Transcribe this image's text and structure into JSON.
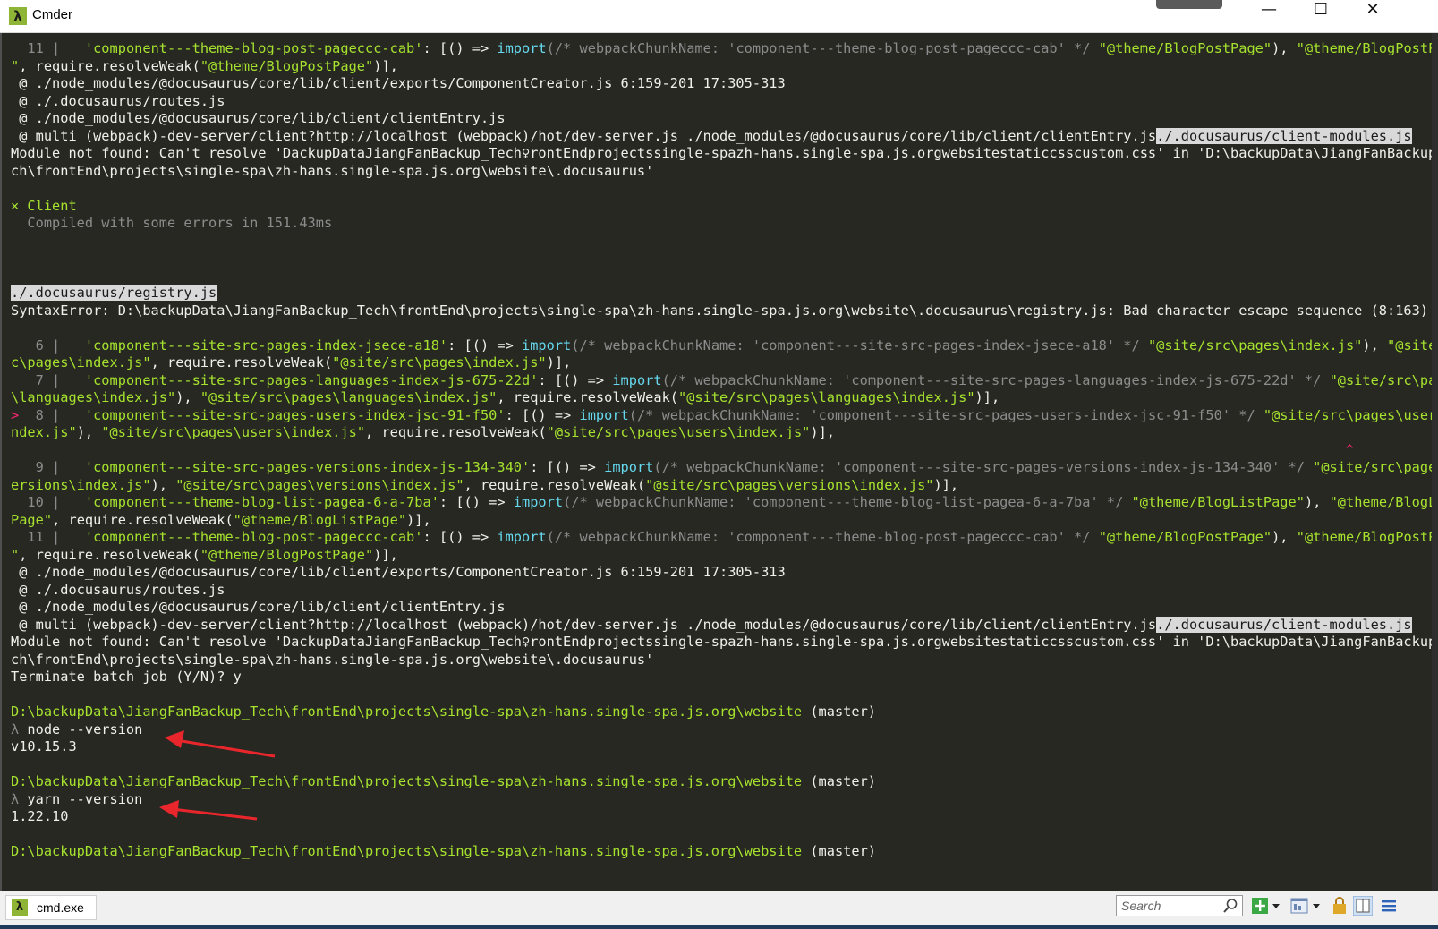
{
  "window": {
    "title": "Cmder",
    "ghost_tabs": [
      "...",
      "...",
      "...",
      "...",
      "...",
      "..."
    ],
    "controls": {
      "minimize": "—",
      "maximize": "☐",
      "close": "✕"
    }
  },
  "terminal": {
    "lines": [
      {
        "segs": [
          [
            "  11 | ",
            "gray"
          ],
          [
            "  ",
            ""
          ],
          [
            "'component---theme-blog-post-pageccc-cab'",
            "gn"
          ],
          [
            ": [() => ",
            ""
          ],
          [
            "import",
            "bl"
          ],
          [
            "(/* webpackChunkName: 'component---theme-blog-post-pageccc-cab' */ ",
            "gray"
          ],
          [
            "\"@theme/BlogPostPage\"",
            "gn"
          ],
          [
            "), ",
            ""
          ],
          [
            "\"@theme/BlogPostPage",
            "gn"
          ]
        ]
      },
      {
        "segs": [
          [
            "\"",
            "gn"
          ],
          [
            ", require.resolveWeak(",
            ""
          ],
          [
            "\"@theme/BlogPostPage\"",
            "gn"
          ],
          [
            ")],",
            ""
          ]
        ]
      },
      {
        "segs": [
          [
            " @ ./node_modules/@docusaurus/core/lib/client/exports/ComponentCreator.js 6:159-201 17:305-313",
            ""
          ]
        ]
      },
      {
        "segs": [
          [
            " @ ./.docusaurus/routes.js",
            ""
          ]
        ]
      },
      {
        "segs": [
          [
            " @ ./node_modules/@docusaurus/core/lib/client/clientEntry.js",
            ""
          ]
        ]
      },
      {
        "segs": [
          [
            " @ multi (webpack)-dev-server/client?http://localhost (webpack)/hot/dev-server.js ./node_modules/@docusaurus/core/lib/client/clientEntry.js",
            ""
          ],
          [
            "./.docusaurus/client-modules.js",
            "hl"
          ]
        ]
      },
      {
        "segs": [
          [
            "Module not found: Can't resolve 'DackupDataJiangFanBackup_Tech♀rontEndprojectssingle-spazh-hans.single-spa.js.orgwebsitestaticcsscustom.css' in 'D:\\backupData\\JiangFanBackup_Te",
            ""
          ]
        ]
      },
      {
        "segs": [
          [
            "ch\\frontEnd\\projects\\single-spa\\zh-hans.single-spa.js.org\\website\\.docusaurus'",
            ""
          ]
        ]
      },
      {
        "segs": [
          [
            "",
            ""
          ]
        ]
      },
      {
        "segs": [
          [
            "× Client",
            "gn"
          ]
        ]
      },
      {
        "segs": [
          [
            "  Compiled with some errors in 151.43ms",
            "gray"
          ]
        ]
      },
      {
        "segs": [
          [
            "",
            ""
          ]
        ]
      },
      {
        "segs": [
          [
            "",
            ""
          ]
        ]
      },
      {
        "segs": [
          [
            "",
            ""
          ]
        ]
      },
      {
        "segs": [
          [
            "./.docusaurus/registry.js",
            "hl"
          ]
        ]
      },
      {
        "segs": [
          [
            "SyntaxError: D:\\backupData\\JiangFanBackup_Tech\\frontEnd\\projects\\single-spa\\zh-hans.single-spa.js.org\\website\\.docusaurus\\registry.js: Bad character escape sequence (8:163)",
            ""
          ]
        ]
      },
      {
        "segs": [
          [
            "",
            ""
          ]
        ]
      },
      {
        "segs": [
          [
            "   6 | ",
            "gray"
          ],
          [
            "  ",
            ""
          ],
          [
            "'component---site-src-pages-index-jsece-a18'",
            "gn"
          ],
          [
            ": [() => ",
            ""
          ],
          [
            "import",
            "bl"
          ],
          [
            "(/* webpackChunkName: 'component---site-src-pages-index-jsece-a18' */ ",
            "gray"
          ],
          [
            "\"@site/src\\pages\\index.js\"",
            "gn"
          ],
          [
            "), ",
            ""
          ],
          [
            "\"@site/sr",
            "gn"
          ]
        ]
      },
      {
        "segs": [
          [
            "c\\pages\\index.js\"",
            "gn"
          ],
          [
            ", require.resolveWeak(",
            ""
          ],
          [
            "\"@site/src\\pages\\index.js\"",
            "gn"
          ],
          [
            ")],",
            ""
          ]
        ]
      },
      {
        "segs": [
          [
            "   7 | ",
            "gray"
          ],
          [
            "  ",
            ""
          ],
          [
            "'component---site-src-pages-languages-index-js-675-22d'",
            "gn"
          ],
          [
            ": [() => ",
            ""
          ],
          [
            "import",
            "bl"
          ],
          [
            "(/* webpackChunkName: 'component---site-src-pages-languages-index-js-675-22d' */ ",
            "gray"
          ],
          [
            "\"@site/src\\pages",
            "gn"
          ]
        ]
      },
      {
        "segs": [
          [
            "\\languages\\index.js\"",
            "gn"
          ],
          [
            "), ",
            ""
          ],
          [
            "\"@site/src\\pages\\languages\\index.js\"",
            "gn"
          ],
          [
            ", require.resolveWeak(",
            ""
          ],
          [
            "\"@site/src\\pages\\languages\\index.js\"",
            "gn"
          ],
          [
            ")],",
            ""
          ]
        ]
      },
      {
        "segs": [
          [
            "> ",
            "rd"
          ],
          [
            " 8 | ",
            "gray"
          ],
          [
            "  ",
            ""
          ],
          [
            "'component---site-src-pages-users-index-jsc-91-f50'",
            "gn"
          ],
          [
            ": [() => ",
            ""
          ],
          [
            "import",
            "bl"
          ],
          [
            "(/* webpackChunkName: 'component---site-src-pages-users-index-jsc-91-f50' */ ",
            "gray"
          ],
          [
            "\"@site/src\\pages\\users\\i",
            "gn"
          ]
        ]
      },
      {
        "segs": [
          [
            "ndex.js\"",
            "gn"
          ],
          [
            "), ",
            ""
          ],
          [
            "\"@site/src\\pages\\users\\index.js\"",
            "gn"
          ],
          [
            ", require.resolveWeak(",
            ""
          ],
          [
            "\"@site/src\\pages\\users\\index.js\"",
            "gn"
          ],
          [
            ")],",
            ""
          ]
        ]
      },
      {
        "segs": [
          [
            "",
            ""
          ]
        ]
      },
      {
        "segs": [
          [
            "   9 | ",
            "gray"
          ],
          [
            "  ",
            ""
          ],
          [
            "'component---site-src-pages-versions-index-js-134-340'",
            "gn"
          ],
          [
            ": [() => ",
            ""
          ],
          [
            "import",
            "bl"
          ],
          [
            "(/* webpackChunkName: 'component---site-src-pages-versions-index-js-134-340' */ ",
            "gray"
          ],
          [
            "\"@site/src\\pages\\v",
            "gn"
          ]
        ]
      },
      {
        "segs": [
          [
            "ersions\\index.js\"",
            "gn"
          ],
          [
            "), ",
            ""
          ],
          [
            "\"@site/src\\pages\\versions\\index.js\"",
            "gn"
          ],
          [
            ", require.resolveWeak(",
            ""
          ],
          [
            "\"@site/src\\pages\\versions\\index.js\"",
            "gn"
          ],
          [
            ")],",
            ""
          ]
        ]
      },
      {
        "segs": [
          [
            "  10 | ",
            "gray"
          ],
          [
            "  ",
            ""
          ],
          [
            "'component---theme-blog-list-pagea-6-a-7ba'",
            "gn"
          ],
          [
            ": [() => ",
            ""
          ],
          [
            "import",
            "bl"
          ],
          [
            "(/* webpackChunkName: 'component---theme-blog-list-pagea-6-a-7ba' */ ",
            "gray"
          ],
          [
            "\"@theme/BlogListPage\"",
            "gn"
          ],
          [
            "), ",
            ""
          ],
          [
            "\"@theme/BlogList",
            "gn"
          ]
        ]
      },
      {
        "segs": [
          [
            "Page\"",
            "gn"
          ],
          [
            ", require.resolveWeak(",
            ""
          ],
          [
            "\"@theme/BlogListPage\"",
            "gn"
          ],
          [
            ")],",
            ""
          ]
        ]
      },
      {
        "segs": [
          [
            "  11 | ",
            "gray"
          ],
          [
            "  ",
            ""
          ],
          [
            "'component---theme-blog-post-pageccc-cab'",
            "gn"
          ],
          [
            ": [() => ",
            ""
          ],
          [
            "import",
            "bl"
          ],
          [
            "(/* webpackChunkName: 'component---theme-blog-post-pageccc-cab' */ ",
            "gray"
          ],
          [
            "\"@theme/BlogPostPage\"",
            "gn"
          ],
          [
            "), ",
            ""
          ],
          [
            "\"@theme/BlogPostPage",
            "gn"
          ]
        ]
      },
      {
        "segs": [
          [
            "\"",
            "gn"
          ],
          [
            ", require.resolveWeak(",
            ""
          ],
          [
            "\"@theme/BlogPostPage\"",
            "gn"
          ],
          [
            ")],",
            ""
          ]
        ]
      },
      {
        "segs": [
          [
            " @ ./node_modules/@docusaurus/core/lib/client/exports/ComponentCreator.js 6:159-201 17:305-313",
            ""
          ]
        ]
      },
      {
        "segs": [
          [
            " @ ./.docusaurus/routes.js",
            ""
          ]
        ]
      },
      {
        "segs": [
          [
            " @ ./node_modules/@docusaurus/core/lib/client/clientEntry.js",
            ""
          ]
        ]
      },
      {
        "segs": [
          [
            " @ multi (webpack)-dev-server/client?http://localhost (webpack)/hot/dev-server.js ./node_modules/@docusaurus/core/lib/client/clientEntry.js",
            ""
          ],
          [
            "./.docusaurus/client-modules.js",
            "hl"
          ]
        ]
      },
      {
        "segs": [
          [
            "Module not found: Can't resolve 'DackupDataJiangFanBackup_Tech♀rontEndprojectssingle-spazh-hans.single-spa.js.orgwebsitestaticcsscustom.css' in 'D:\\backupData\\JiangFanBackup_Te",
            ""
          ]
        ]
      },
      {
        "segs": [
          [
            "ch\\frontEnd\\projects\\single-spa\\zh-hans.single-spa.js.org\\website\\.docusaurus'",
            ""
          ]
        ]
      },
      {
        "segs": [
          [
            "Terminate batch job (Y/N)? y",
            ""
          ]
        ]
      },
      {
        "segs": [
          [
            "",
            ""
          ]
        ]
      },
      {
        "segs": [
          [
            "D:\\backupData\\JiangFanBackup_Tech\\frontEnd\\projects\\single-spa\\zh-hans.single-spa.js.org\\website",
            "gn"
          ],
          [
            " (master)",
            ""
          ]
        ]
      },
      {
        "segs": [
          [
            "λ ",
            "gray"
          ],
          [
            "node --version",
            ""
          ]
        ]
      },
      {
        "segs": [
          [
            "v10.15.3",
            ""
          ]
        ]
      },
      {
        "segs": [
          [
            "",
            ""
          ]
        ]
      },
      {
        "segs": [
          [
            "D:\\backupData\\JiangFanBackup_Tech\\frontEnd\\projects\\single-spa\\zh-hans.single-spa.js.org\\website",
            "gn"
          ],
          [
            " (master)",
            ""
          ]
        ]
      },
      {
        "segs": [
          [
            "λ ",
            "gray"
          ],
          [
            "yarn --version",
            ""
          ]
        ]
      },
      {
        "segs": [
          [
            "1.22.10",
            ""
          ]
        ]
      },
      {
        "segs": [
          [
            "",
            ""
          ]
        ]
      },
      {
        "segs": [
          [
            "D:\\backupData\\JiangFanBackup_Tech\\frontEnd\\projects\\single-spa\\zh-hans.single-spa.js.org\\website",
            "gn"
          ],
          [
            " (master)",
            ""
          ]
        ]
      }
    ]
  },
  "status_bar": {
    "tab_label": "cmd.exe",
    "search_placeholder": "Search"
  },
  "colors": {
    "background": "#272822",
    "path_green": "#a6e22e",
    "keyword_blue": "#66d9ef",
    "error_red": "#f92672",
    "annotation_arrow": "#e8262c"
  },
  "icons": [
    "lambda-icon",
    "search-icon",
    "new-console-icon",
    "dropdown-icon",
    "layout-icon",
    "lock-icon",
    "split-view-icon",
    "menu-icon"
  ]
}
